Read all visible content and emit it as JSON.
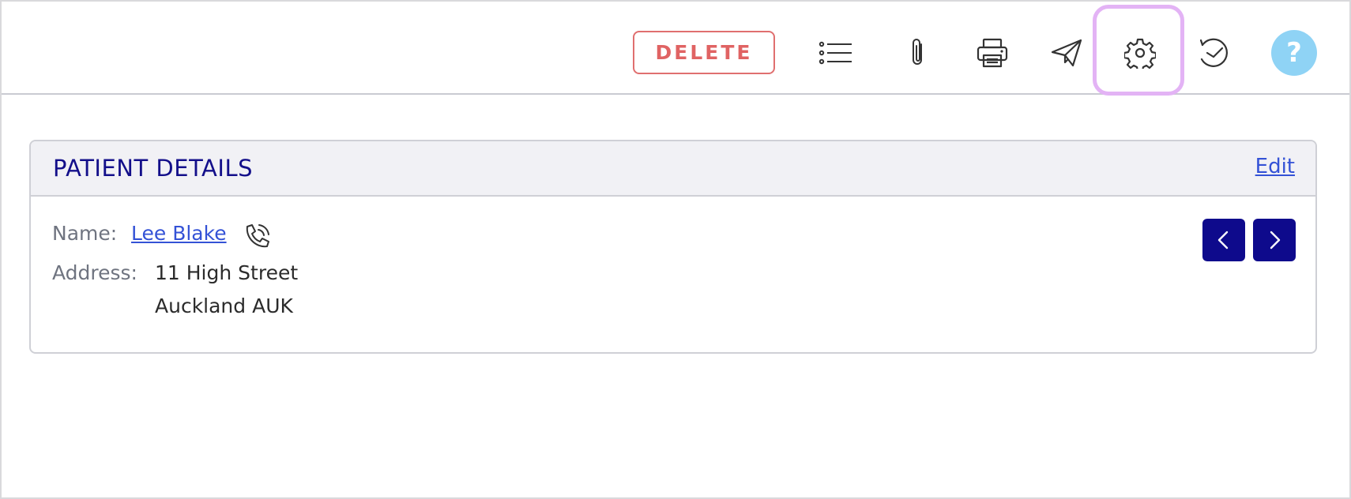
{
  "toolbar": {
    "delete_label": "DELETE",
    "help_label": "?",
    "icons": [
      "list-icon",
      "paperclip-icon",
      "printer-icon",
      "send-icon",
      "gear-icon",
      "history-icon",
      "help-icon"
    ],
    "highlight_color": "#e3b3f5"
  },
  "patient_details": {
    "title": "PATIENT DETAILS",
    "edit_label": "Edit",
    "name_label": "Name:",
    "name_value": "Lee Blake",
    "address_label": "Address:",
    "address_line1": "11 High Street",
    "address_line2": "Auckland AUK"
  },
  "colors": {
    "brand_navy": "#0e0a8c",
    "link_blue": "#3452d6",
    "delete_red": "#e06363",
    "help_blue": "#8fd3f5"
  }
}
